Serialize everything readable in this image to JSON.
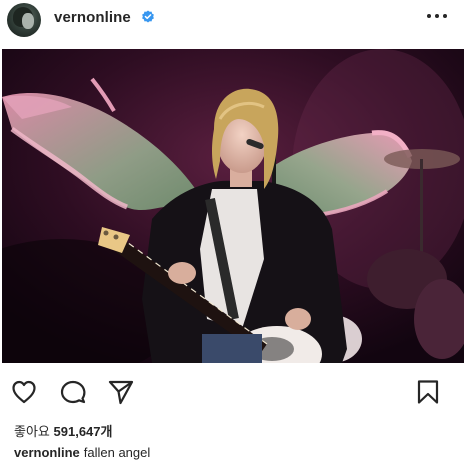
{
  "header": {
    "username": "vernonline",
    "verified_icon": "verified-badge-icon",
    "more_icon": "more-options-icon"
  },
  "post": {
    "image_description_icon": "post-photo"
  },
  "actions": {
    "like_icon": "heart-icon",
    "comment_icon": "comment-icon",
    "share_icon": "send-icon",
    "save_icon": "bookmark-icon"
  },
  "likes": {
    "label": "좋아요",
    "count": "591,647개"
  },
  "caption": {
    "username": "vernonline",
    "text": "fallen angel"
  },
  "colors": {
    "text": "#262626",
    "verified": "#3897f0",
    "background": "#ffffff"
  }
}
